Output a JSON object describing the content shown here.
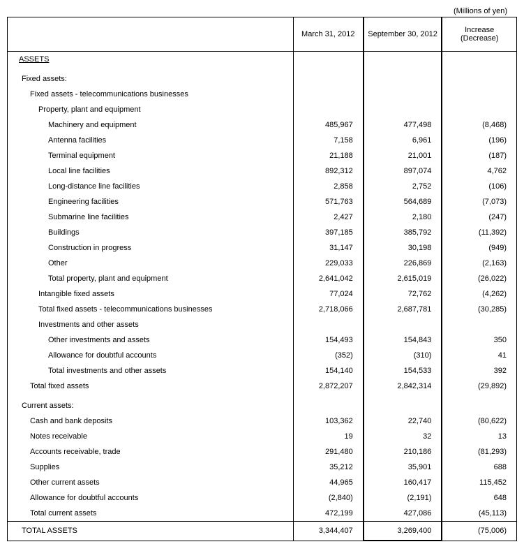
{
  "unit": "(Millions of yen)",
  "headers": {
    "col1": "March 31, 2012",
    "col2": "September 30, 2012",
    "col3_line1": "Increase",
    "col3_line2": "(Decrease)"
  },
  "section_assets": "ASSETS",
  "labels": {
    "fixed_assets": "Fixed assets:",
    "fa_telecom": "Fixed assets - telecommunications businesses",
    "ppe": "Property, plant and equipment",
    "machinery": "Machinery and equipment",
    "antenna": "Antenna facilities",
    "terminal": "Terminal equipment",
    "local_line": "Local line facilities",
    "long_dist": "Long-distance line facilities",
    "engineering": "Engineering facilities",
    "submarine": "Submarine line facilities",
    "buildings": "Buildings",
    "cip": "Construction in progress",
    "other_ppe": "Other",
    "total_ppe": "Total property, plant and equipment",
    "intangible": "Intangible fixed assets",
    "total_fa_telecom": "Total fixed assets - telecommunications businesses",
    "inv_other": "Investments and other assets",
    "other_inv": "Other investments and assets",
    "allowance1": "Allowance for doubtful accounts",
    "total_inv": "Total investments and other assets",
    "total_fixed": "Total fixed assets",
    "current_assets": "Current assets:",
    "cash": "Cash and bank deposits",
    "notes": "Notes receivable",
    "ar_trade": "Accounts receivable, trade",
    "supplies": "Supplies",
    "other_current": "Other current assets",
    "allowance2": "Allowance for doubtful accounts",
    "total_current": "Total current assets",
    "total_assets": "TOTAL ASSETS"
  },
  "chart_data": {
    "type": "table",
    "columns": [
      "March 31, 2012",
      "September 30, 2012",
      "Increase (Decrease)"
    ],
    "rows": {
      "machinery": [
        "485,967",
        "477,498",
        "(8,468)"
      ],
      "antenna": [
        "7,158",
        "6,961",
        "(196)"
      ],
      "terminal": [
        "21,188",
        "21,001",
        "(187)"
      ],
      "local_line": [
        "892,312",
        "897,074",
        "4,762"
      ],
      "long_dist": [
        "2,858",
        "2,752",
        "(106)"
      ],
      "engineering": [
        "571,763",
        "564,689",
        "(7,073)"
      ],
      "submarine": [
        "2,427",
        "2,180",
        "(247)"
      ],
      "buildings": [
        "397,185",
        "385,792",
        "(11,392)"
      ],
      "cip": [
        "31,147",
        "30,198",
        "(949)"
      ],
      "other_ppe": [
        "229,033",
        "226,869",
        "(2,163)"
      ],
      "total_ppe": [
        "2,641,042",
        "2,615,019",
        "(26,022)"
      ],
      "intangible": [
        "77,024",
        "72,762",
        "(4,262)"
      ],
      "total_fa_telecom": [
        "2,718,066",
        "2,687,781",
        "(30,285)"
      ],
      "other_inv": [
        "154,493",
        "154,843",
        "350"
      ],
      "allowance1": [
        "(352)",
        "(310)",
        "41"
      ],
      "total_inv": [
        "154,140",
        "154,533",
        "392"
      ],
      "total_fixed": [
        "2,872,207",
        "2,842,314",
        "(29,892)"
      ],
      "cash": [
        "103,362",
        "22,740",
        "(80,622)"
      ],
      "notes": [
        "19",
        "32",
        "13"
      ],
      "ar_trade": [
        "291,480",
        "210,186",
        "(81,293)"
      ],
      "supplies": [
        "35,212",
        "35,901",
        "688"
      ],
      "other_current": [
        "44,965",
        "160,417",
        "115,452"
      ],
      "allowance2": [
        "(2,840)",
        "(2,191)",
        "648"
      ],
      "total_current": [
        "472,199",
        "427,086",
        "(45,113)"
      ],
      "total_assets": [
        "3,344,407",
        "3,269,400",
        "(75,006)"
      ]
    }
  }
}
